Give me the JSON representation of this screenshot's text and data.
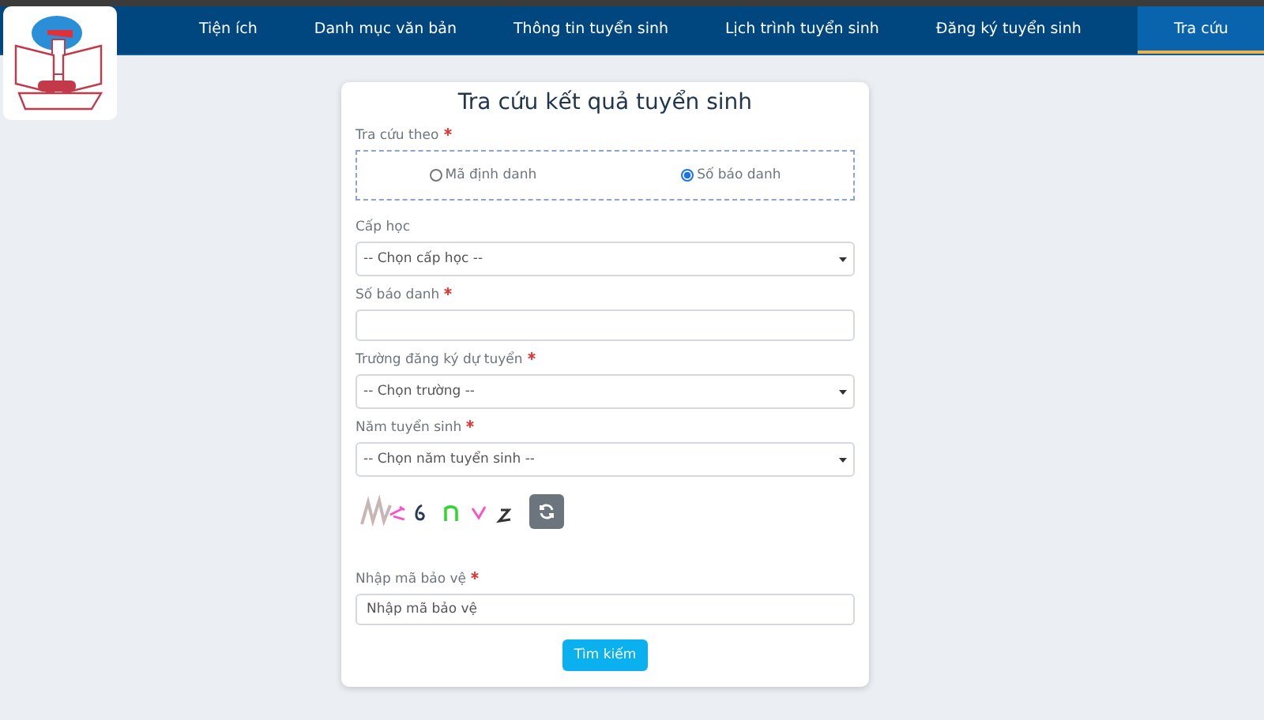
{
  "nav": {
    "items": [
      {
        "label": "Tiện ích",
        "selected": false
      },
      {
        "label": "Danh mục văn bản",
        "selected": false
      },
      {
        "label": "Thông tin tuyển sinh",
        "selected": false
      },
      {
        "label": "Lịch trình tuyển sinh",
        "selected": false
      },
      {
        "label": "Đăng ký tuyển sinh",
        "selected": false
      },
      {
        "label": "Tra cứu",
        "selected": true
      }
    ]
  },
  "form": {
    "title": "Tra cứu kết quả tuyển sinh",
    "fields": [
      {
        "kind": "radio",
        "label": "Tra cứu theo",
        "required": true,
        "options": [
          {
            "label": "Mã định danh",
            "selected": false
          },
          {
            "label": "Số báo danh",
            "selected": true
          }
        ]
      },
      {
        "kind": "select",
        "label": "Cấp học",
        "required": false,
        "value": "-- Chọn cấp học --"
      },
      {
        "kind": "text",
        "label": "Số báo danh",
        "required": true
      },
      {
        "kind": "select",
        "label": "Trường đăng ký dự tuyển",
        "required": true,
        "value": "-- Chọn trường --"
      },
      {
        "kind": "select",
        "label": "Năm tuyển sinh",
        "required": true,
        "value": "-- Chọn năm tuyển sinh --"
      },
      {
        "kind": "captcha"
      },
      {
        "kind": "text",
        "label": "Nhập mã bảo vệ",
        "required": true,
        "placeholder": "Nhập mã bảo vệ"
      }
    ],
    "submit": "Tìm kiếm"
  }
}
